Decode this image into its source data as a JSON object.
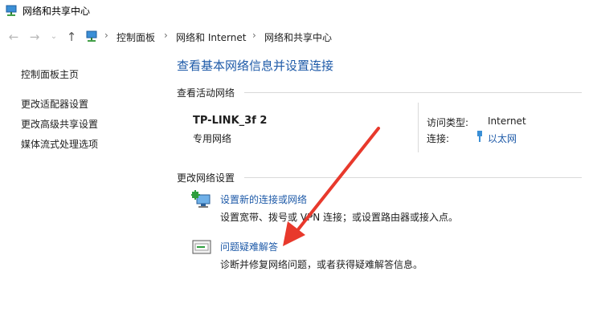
{
  "window": {
    "title": "网络和共享中心",
    "icon": "network-center-icon"
  },
  "nav": {
    "back_icon": "back-arrow-icon",
    "forward_icon": "forward-arrow-icon",
    "recent_icon": "chevron-down-icon",
    "up_icon": "up-arrow-icon",
    "location_icon": "network-center-icon",
    "breadcrumb": [
      "控制面板",
      "网络和 Internet",
      "网络和共享中心"
    ]
  },
  "sidebar": {
    "items": [
      {
        "label": "控制面板主页"
      },
      {
        "label": "更改适配器设置"
      },
      {
        "label": "更改高级共享设置"
      },
      {
        "label": "媒体流式处理选项"
      }
    ]
  },
  "main": {
    "title": "查看基本网络信息并设置连接",
    "active_section": "查看活动网络",
    "network": {
      "name": "TP-LINK_3f 2",
      "type": "专用网络",
      "access_type_label": "访问类型:",
      "access_type_value": "Internet",
      "connection_label": "连接:",
      "connection_value": "以太网",
      "connection_icon": "ethernet-icon"
    },
    "change_section": "更改网络设置",
    "tasks": [
      {
        "icon": "new-connection-icon",
        "link": "设置新的连接或网络",
        "desc": "设置宽带、拨号或 VPN 连接；或设置路由器或接入点。"
      },
      {
        "icon": "troubleshoot-icon",
        "link": "问题疑难解答",
        "desc": "诊断并修复网络问题，或者获得疑难解答信息。"
      }
    ]
  },
  "annotation": {
    "arrow_color": "#e8392c"
  }
}
